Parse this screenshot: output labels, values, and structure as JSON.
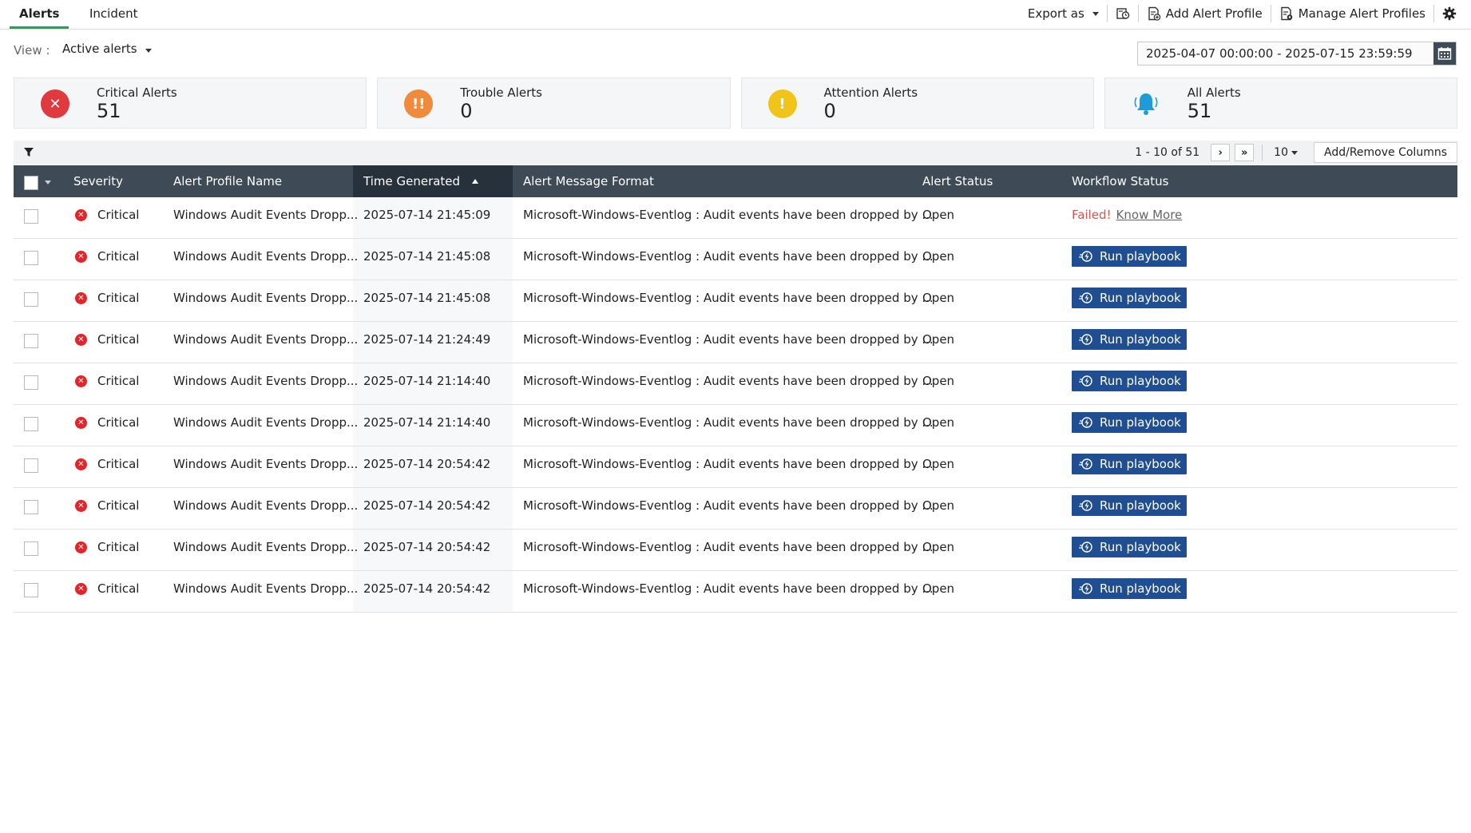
{
  "tabs": [
    {
      "label": "Alerts",
      "active": true
    },
    {
      "label": "Incident",
      "active": false
    }
  ],
  "top_actions": {
    "export_label": "Export as",
    "schedule_icon": "schedule-report-icon",
    "add_profile_label": "Add Alert Profile",
    "manage_profiles_label": "Manage Alert Profiles",
    "settings_icon": "gear-icon"
  },
  "view": {
    "label": "View :",
    "selected": "Active alerts"
  },
  "date_range": "2025-04-07 00:00:00 - 2025-07-15 23:59:59",
  "cards": [
    {
      "title": "Critical Alerts",
      "count": "51",
      "color": "#e0393e",
      "icon": "critical-x-icon"
    },
    {
      "title": "Trouble Alerts",
      "count": "0",
      "color": "#f08a3c",
      "icon": "trouble-exclamation-icon"
    },
    {
      "title": "Attention Alerts",
      "count": "0",
      "color": "#f0c419",
      "icon": "attention-exclamation-icon"
    },
    {
      "title": "All Alerts",
      "count": "51",
      "color": "#1f9bd7",
      "icon": "bell-icon"
    }
  ],
  "pager": {
    "range": "1 - 10 of 51",
    "page_size": "10",
    "add_remove_columns": "Add/Remove Columns"
  },
  "columns": {
    "severity": "Severity",
    "profile": "Alert Profile Name",
    "time": "Time Generated",
    "message": "Alert Message Format",
    "status": "Alert Status",
    "workflow": "Workflow Status"
  },
  "rows": [
    {
      "severity": "Critical",
      "profile": "Windows Audit Events Dropp...",
      "time": "2025-07-14 21:45:09",
      "message": "Microsoft-Windows-Eventlog : Audit events have been dropped by ...",
      "status": "Open",
      "workflow": "failed"
    },
    {
      "severity": "Critical",
      "profile": "Windows Audit Events Dropp...",
      "time": "2025-07-14 21:45:08",
      "message": "Microsoft-Windows-Eventlog : Audit events have been dropped by ...",
      "status": "Open",
      "workflow": "run"
    },
    {
      "severity": "Critical",
      "profile": "Windows Audit Events Dropp...",
      "time": "2025-07-14 21:45:08",
      "message": "Microsoft-Windows-Eventlog : Audit events have been dropped by ...",
      "status": "Open",
      "workflow": "run"
    },
    {
      "severity": "Critical",
      "profile": "Windows Audit Events Dropp...",
      "time": "2025-07-14 21:24:49",
      "message": "Microsoft-Windows-Eventlog : Audit events have been dropped by ...",
      "status": "Open",
      "workflow": "run"
    },
    {
      "severity": "Critical",
      "profile": "Windows Audit Events Dropp...",
      "time": "2025-07-14 21:14:40",
      "message": "Microsoft-Windows-Eventlog : Audit events have been dropped by ...",
      "status": "Open",
      "workflow": "run"
    },
    {
      "severity": "Critical",
      "profile": "Windows Audit Events Dropp...",
      "time": "2025-07-14 21:14:40",
      "message": "Microsoft-Windows-Eventlog : Audit events have been dropped by ...",
      "status": "Open",
      "workflow": "run"
    },
    {
      "severity": "Critical",
      "profile": "Windows Audit Events Dropp...",
      "time": "2025-07-14 20:54:42",
      "message": "Microsoft-Windows-Eventlog : Audit events have been dropped by ...",
      "status": "Open",
      "workflow": "run"
    },
    {
      "severity": "Critical",
      "profile": "Windows Audit Events Dropp...",
      "time": "2025-07-14 20:54:42",
      "message": "Microsoft-Windows-Eventlog : Audit events have been dropped by ...",
      "status": "Open",
      "workflow": "run"
    },
    {
      "severity": "Critical",
      "profile": "Windows Audit Events Dropp...",
      "time": "2025-07-14 20:54:42",
      "message": "Microsoft-Windows-Eventlog : Audit events have been dropped by ...",
      "status": "Open",
      "workflow": "run"
    },
    {
      "severity": "Critical",
      "profile": "Windows Audit Events Dropp...",
      "time": "2025-07-14 20:54:42",
      "message": "Microsoft-Windows-Eventlog : Audit events have been dropped by ...",
      "status": "Open",
      "workflow": "run"
    }
  ],
  "workflow_labels": {
    "failed": "Failed!",
    "know_more": "Know More",
    "run": "Run playbook"
  }
}
